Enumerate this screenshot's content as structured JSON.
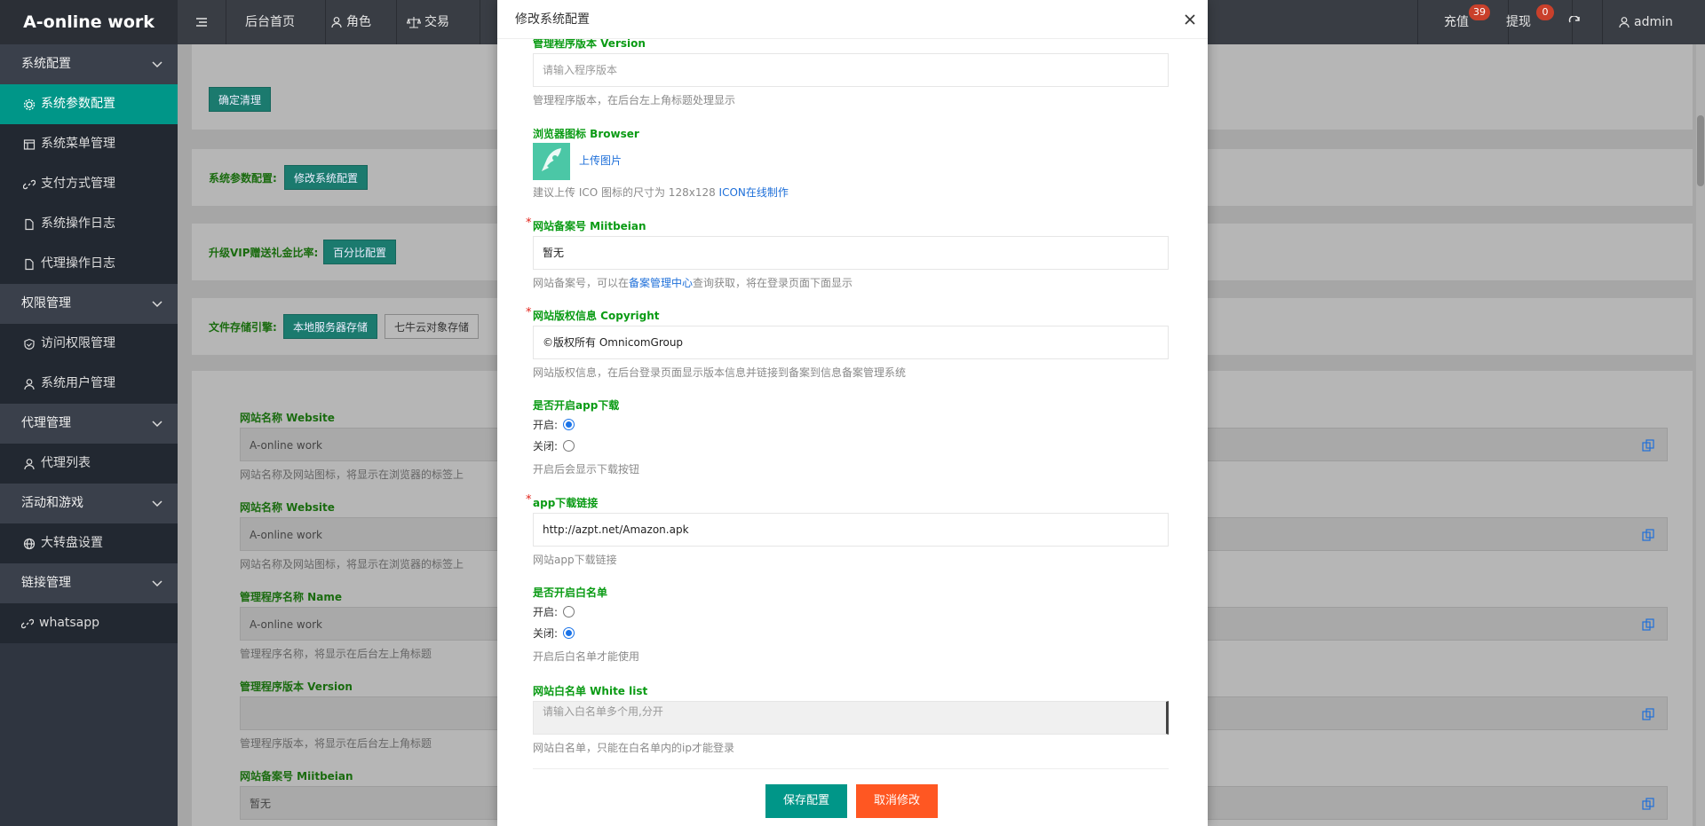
{
  "app": {
    "logo": "A-online work"
  },
  "sidebar": {
    "groups": [
      {
        "label": "系统配置",
        "items": [
          {
            "label": "系统参数配置",
            "icon": "gear-icon",
            "active": true
          },
          {
            "label": "系统菜单管理",
            "icon": "table-icon"
          },
          {
            "label": "支付方式管理",
            "icon": "link-icon"
          },
          {
            "label": "系统操作日志",
            "icon": "file-icon"
          },
          {
            "label": "代理操作日志",
            "icon": "file-icon"
          }
        ]
      },
      {
        "label": "权限管理",
        "items": [
          {
            "label": "访问权限管理",
            "icon": "shield-icon"
          },
          {
            "label": "系统用户管理",
            "icon": "user-icon"
          }
        ]
      },
      {
        "label": "代理管理",
        "items": [
          {
            "label": "代理列表",
            "icon": "user-icon"
          }
        ]
      },
      {
        "label": "活动和游戏",
        "items": [
          {
            "label": "大转盘设置",
            "icon": "globe-icon"
          }
        ]
      },
      {
        "label": "链接管理",
        "items": []
      }
    ],
    "whatsapp": "whatsapp"
  },
  "topbar": {
    "nav": [
      "后台首页",
      "角色",
      "交易"
    ],
    "recharge": "充值",
    "recharge_badge": "39",
    "withdraw": "提现",
    "withdraw_badge": "0",
    "user": "admin"
  },
  "main": {
    "clear_btn": "确定清理",
    "sysparam_label": "系统参数配置:",
    "sysparam_btn": "修改系统配置",
    "vip_label": "升级VIP赠送礼金比率:",
    "vip_btn": "百分比配置",
    "storage_label": "文件存储引擎:",
    "storage_local": "本地服务器存储",
    "storage_qiniu": "七牛云对象存储",
    "fields": [
      {
        "label": "网站名称 Website",
        "value": "A-online work",
        "help": "网站名称及网站图标，将显示在浏览器的标签上"
      },
      {
        "label": "网站名称 Website",
        "value": "A-online work",
        "help": "网站名称及网站图标，将显示在浏览器的标签上"
      },
      {
        "label": "管理程序名称 Name",
        "value": "A-online work",
        "help": "管理程序名称，将显示在后台左上角标题"
      },
      {
        "label": "管理程序版本 Version",
        "value": "",
        "help": "管理程序版本，将显示在后台左上角标题"
      },
      {
        "label": "网站备案号 Miitbeian",
        "value": "暂无",
        "help": ""
      }
    ]
  },
  "modal": {
    "title": "修改系统配置",
    "version_label": "管理程序版本 Version",
    "version_placeholder": "请输入程序版本",
    "version_help": "管理程序版本，在后台左上角标题处理显示",
    "browser_label": "浏览器图标 Browser",
    "upload_link": "上传图片",
    "browser_help": "建议上传 ICO 图标的尺寸为 128x128",
    "browser_help_link": "ICON在线制作",
    "miit_label": "网站备案号 Miitbeian",
    "miit_value": "暂无",
    "miit_help_pre": "网站备案号，可以在",
    "miit_help_link": "备案管理中心",
    "miit_help_post": "查询获取，将在登录页面下面显示",
    "copyright_label": "网站版权信息 Copyright",
    "copyright_value": "©版权所有 OmnicomGroup",
    "copyright_help": "网站版权信息，在后台登录页面显示版本信息并链接到备案到信息备案管理系统",
    "app_label": "是否开启app下载",
    "on": "开启:",
    "off": "关闭:",
    "app_help": "开启后会显示下载按钮",
    "app_url_label": "app下载链接",
    "app_url_value": "http://azpt.net/Amazon.apk",
    "app_url_help": "网站app下载链接",
    "whitelist_toggle_label": "是否开启白名单",
    "whitelist_toggle_help": "开启后白名单才能使用",
    "whitelist_label": "网站白名单 White list",
    "whitelist_placeholder": "请输入白名单多个用,分开",
    "whitelist_help": "网站白名单，只能在白名单内的ip才能登录",
    "save": "保存配置",
    "cancel": "取消修改"
  },
  "colors": {
    "accent": "#009688",
    "cancel": "#ff5722",
    "label_green": "#0a9b14",
    "sidebar": "#2f3540"
  }
}
